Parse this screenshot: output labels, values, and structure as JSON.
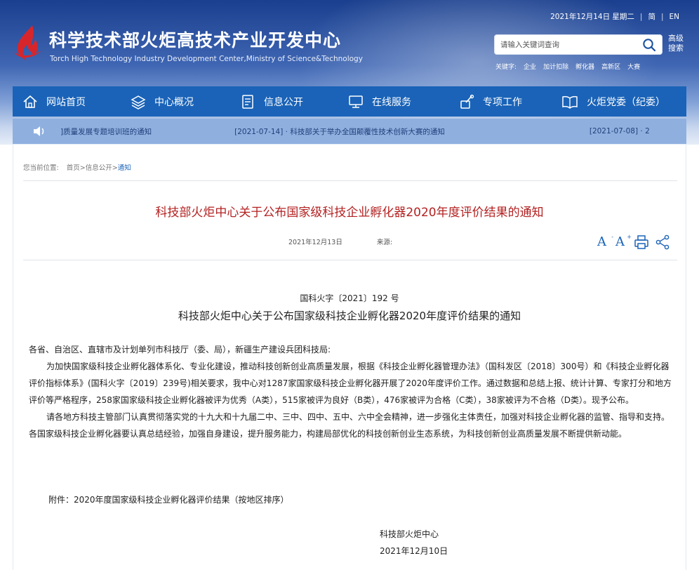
{
  "header": {
    "title": "科学技术部火炬高技术产业开发中心",
    "subtitle": "Torch High Technology Industry Development Center,Ministry of Science&Technology",
    "date": "2021年12月14日 星期二",
    "lang_traditional": "简",
    "lang_english": "EN",
    "search_placeholder": "请输入关键词查询",
    "advanced_search": "高级搜索",
    "keywords_label": "关键字:",
    "keywords": [
      "企业",
      "加计扣除",
      "孵化器",
      "高新区",
      "大赛"
    ]
  },
  "nav": {
    "items": [
      {
        "label": "网站首页",
        "icon": "home-icon"
      },
      {
        "label": "中心概况",
        "icon": "layers-icon"
      },
      {
        "label": "信息公开",
        "icon": "document-icon"
      },
      {
        "label": "在线服务",
        "icon": "monitor-icon"
      },
      {
        "label": "专项工作",
        "icon": "tools-icon"
      },
      {
        "label": "火炬党委（纪委）",
        "icon": "book-icon"
      }
    ]
  },
  "notice": {
    "item1": "]质量发展专题培训班的通知",
    "item2": "[2021-07-14] · 科技部关于举办全国颠覆性技术创新大赛的通知",
    "item3": "[2021-07-08] · 2"
  },
  "breadcrumb": {
    "prefix": "您当前位置:",
    "home": "首页",
    "section": "信息公开",
    "current": "通知",
    "separator": ">"
  },
  "article": {
    "title": "科技部火炬中心关于公布国家级科技企业孵化器2020年度评价结果的通知",
    "date": "2021年12月13日",
    "source_label": "来源:",
    "doc_number": "国科火字〔2021〕192 号",
    "doc_title": "科技部火炬中心关于公布国家级科技企业孵化器2020年度评价结果的通知",
    "salutation": "各省、自治区、直辖市及计划单列市科技厅（委、局），新疆生产建设兵团科技局:",
    "paragraph1": "为加快国家级科技企业孵化器体系化、专业化建设，推动科技创新创业高质量发展，根据《科技企业孵化器管理办法》（国科发区〔2018〕300号）和《科技企业孵化器评价指标体系》(国科火字〔2019〕239号)相关要求，我中心对1287家国家级科技企业孵化器开展了2020年度评价工作。通过数据和总结上报、统计计算、专家打分和地方评价等严格程序，258家国家级科技企业孵化器被评为优秀（A类），515家被评为良好（B类），476家被评为合格（C类），38家被评为不合格（D类）。现予公布。",
    "paragraph2": "请各地方科技主管部门认真贯彻落实党的十九大和十九届二中、三中、四中、五中、六中全会精神，进一步强化主体责任，加强对科技企业孵化器的监管、指导和支持。各国家级科技企业孵化器要认真总结经验，加强自身建设，提升服务能力，构建局部优化的科技创新创业生态系统，为科技创新创业高质量发展不断提供新动能。",
    "attachment": "附件：2020年度国家级科技企业孵化器评价结果（按地区排序）",
    "signature": "科技部火炬中心",
    "sign_date": "2021年12月10日"
  },
  "tools": {
    "font_larger": "A",
    "font_smaller": "A",
    "font_larger_sup": "-",
    "font_smaller_sup": "+"
  },
  "colors": {
    "nav_blue": "#1a63b8",
    "notice_bar": "#8fb0df",
    "title_red": "#b32121",
    "logo_red": "#d7262b"
  }
}
